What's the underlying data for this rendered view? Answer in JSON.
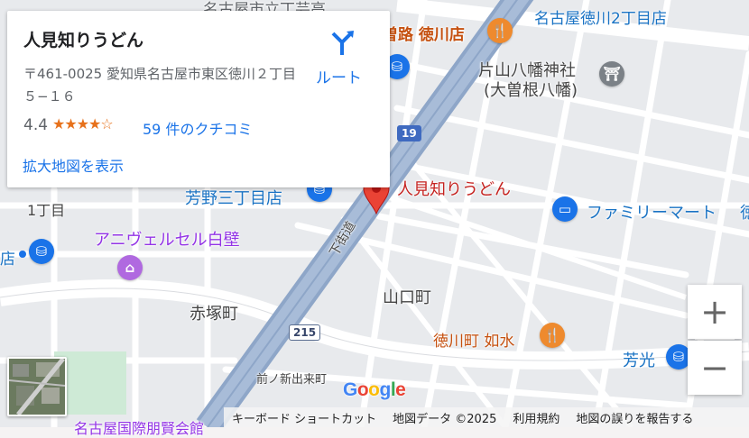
{
  "place_card": {
    "title": "人見知りうどん",
    "address": "〒461-0025 愛知県名古屋市東区徳川２丁目５−１６",
    "rating": "4.4",
    "stars_value": 4.4,
    "reviews_link": "59 件のクチコミ",
    "larger_map_link": "拡大地図を表示",
    "directions_label": "ルート",
    "directions_icon": "directions-arrow-icon"
  },
  "map_labels": {
    "marker_label": "人見知りうどん",
    "nagoya_school_top": "名古屋市立丁芸高",
    "nagoya_tokugawa_2": "名古屋徳川2丁目店",
    "tokugawa_store": "曽路 徳川店",
    "katayama_shrine_1": "片山八幡神社",
    "katayama_shrine_2": "(大曽根八幡)",
    "yoshino_store": "芳野三丁目店",
    "chome_1": "1丁目",
    "anivel": "アニヴェルセル白壁",
    "family_mart": "ファミリーマート",
    "family_mart_cont": "徳",
    "shimokaido": "下街道",
    "yamaguchi": "山口町",
    "akatsuka": "赤塚町",
    "tokugawa_josui": "徳川町 如水",
    "houko": "芳光",
    "maenoshin": "前ノ新出来町",
    "bottom_partial": "名古屋国際朋賢会館",
    "left_store_partial": "店",
    "route_19": "19",
    "route_215": "215"
  },
  "controls": {
    "zoom_in": "+",
    "zoom_out": "−",
    "google_logo": "Google"
  },
  "footer": {
    "shortcuts": "キーボード ショートカット",
    "map_data": "地図データ ©2025",
    "terms": "利用規約",
    "report": "地図の誤りを報告する"
  },
  "colors": {
    "marker": "#ea4335",
    "highway": "#8ea6c8",
    "link": "#1a73e8",
    "star": "#e7711b"
  }
}
